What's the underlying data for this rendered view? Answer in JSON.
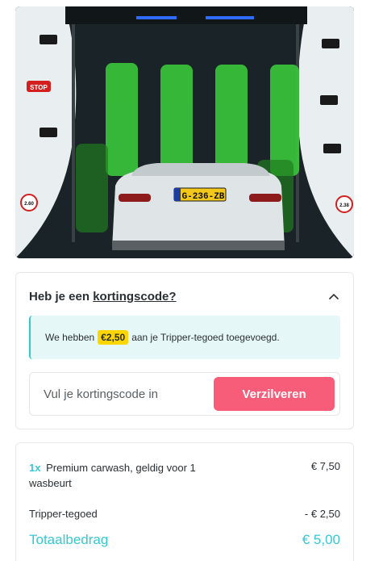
{
  "hero": {
    "plate": "G-236-ZB",
    "stop_sign": "STOP",
    "height_left": "2.60",
    "height_right": "2.38"
  },
  "promo": {
    "title_prefix": "Heb je een",
    "title_link": "kortingscode?",
    "success_prefix": "We hebben",
    "success_amount": "€2,50",
    "success_suffix": "aan je Tripper-tegoed toegevoegd.",
    "input_placeholder": "Vul je kortingscode in",
    "redeem_label": "Verzilveren"
  },
  "order": {
    "product_qty": "1x",
    "product_name": "Premium carwash, geldig voor 1 wasbeurt",
    "product_price": "€ 7,50",
    "credit_label": "Tripper-tegoed",
    "credit_value": "- € 2,50",
    "total_label": "Totaalbedrag",
    "total_value": "€ 5,00"
  },
  "colors": {
    "accent_teal": "#36c7d1",
    "button_pink": "#f75c78",
    "badge_yellow": "#ffd600"
  }
}
